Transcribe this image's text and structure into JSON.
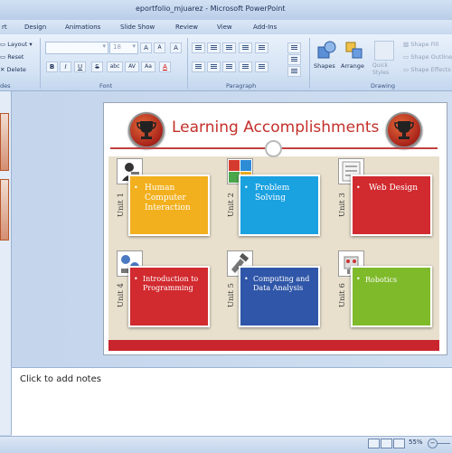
{
  "window": {
    "title": "eportfolio_mjuarez - Microsoft PowerPoint"
  },
  "tabs": [
    {
      "label": "rt"
    },
    {
      "label": "Design"
    },
    {
      "label": "Animations"
    },
    {
      "label": "Slide Show"
    },
    {
      "label": "Review"
    },
    {
      "label": "View"
    },
    {
      "label": "Add-Ins"
    }
  ],
  "ribbon": {
    "slides": {
      "layout": "Layout",
      "reset": "Reset",
      "delete": "Delete",
      "group": "des"
    },
    "font": {
      "font_name": "",
      "font_size": "18",
      "group": "Font",
      "bold": "B",
      "italic": "I",
      "underline": "U",
      "strike": "S",
      "shadow": "abc",
      "spacing": "AV",
      "case": "Aa",
      "color": "A",
      "grow": "A",
      "shrink": "A",
      "clear": "A"
    },
    "paragraph": {
      "group": "Paragraph"
    },
    "drawing": {
      "shapes": "Shapes",
      "arrange": "Arrange",
      "quick_styles": "Quick Styles",
      "shape_fill": "Shape Fill",
      "shape_outline": "Shape Outline",
      "shape_effects": "Shape Effects",
      "group": "Drawing"
    }
  },
  "slide": {
    "title": "Learning Accomplishments",
    "units": [
      {
        "label": "Unit 1",
        "text": "Human Computer Interaction",
        "color": "#f2b01e"
      },
      {
        "label": "Unit 2",
        "text": "Problem Solving",
        "color": "#1aa1e0"
      },
      {
        "label": "Unit 3",
        "text": "Web Design",
        "color": "#d12a2f"
      },
      {
        "label": "Unit 4",
        "text": "Introduction to Programming",
        "color": "#d12a2f"
      },
      {
        "label": "Unit 5",
        "text": "Computing and Data Analysis",
        "color": "#2f56a8"
      },
      {
        "label": "Unit 6",
        "text": "Robotics",
        "color": "#7fba2a"
      }
    ],
    "bullet": "•"
  },
  "notes": {
    "placeholder": "Click to add notes"
  },
  "status": {
    "zoom": "55%"
  },
  "colors": {
    "title_red": "#c4302b",
    "ribbon_bg": "#d3e2f4",
    "accent_blue": "#1c2f55"
  }
}
